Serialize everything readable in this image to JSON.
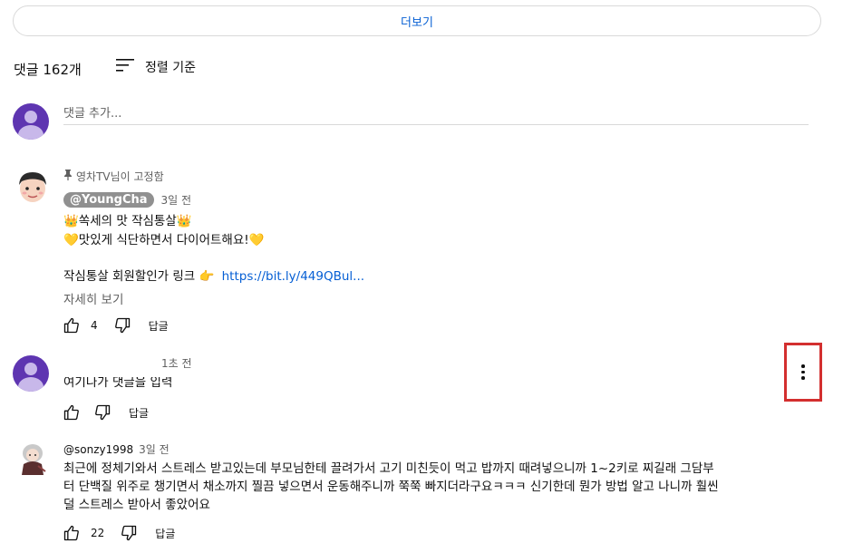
{
  "more_button": "더보기",
  "comments_header": {
    "count_label": "댓글 162개",
    "sort_label": "정렬 기준"
  },
  "add_comment": {
    "placeholder": "댓글 추가..."
  },
  "pinned_comment": {
    "pinned_label": "영차TV님이 고정함",
    "author": "@YoungCha",
    "time": "3일 전",
    "line1": "👑쏙세의 맛 작심통살👑",
    "line2": "💛맛있게 식단하면서 다이어트해요!💛",
    "line3_text": "작심통살 회원할인가 링크 👉",
    "line3_link": "https://bit.ly/449QBul...",
    "read_more": "자세히 보기",
    "likes": "4",
    "reply": "답글"
  },
  "my_comment": {
    "time": "1초 전",
    "text": "여기나가 댓글을 입력",
    "reply": "답글"
  },
  "third_comment": {
    "author": "@sonzy1998",
    "time": "3일 전",
    "line1": "최근에 정체기와서 스트레스 받고있는데 부모님한테 끌려가서 고기 미친듯이 먹고 밥까지 때려넣으니까 1~2키로 찌길래 그담부",
    "line2": "터 단백질 위주로 챙기면서 채소까지 찔끔 넣으면서 운동해주니까 쭉쭉 빠지더라구요ㅋㅋㅋ 신기한데 뭔가 방법 알고 나니까 훨씬",
    "line3": "덜 스트레스 받아서 좋았어요",
    "likes": "22",
    "reply": "답글"
  },
  "colors": {
    "accent": "#065fd4",
    "avatar_purple": "#5e35b1",
    "highlight": "#d32f2f"
  }
}
